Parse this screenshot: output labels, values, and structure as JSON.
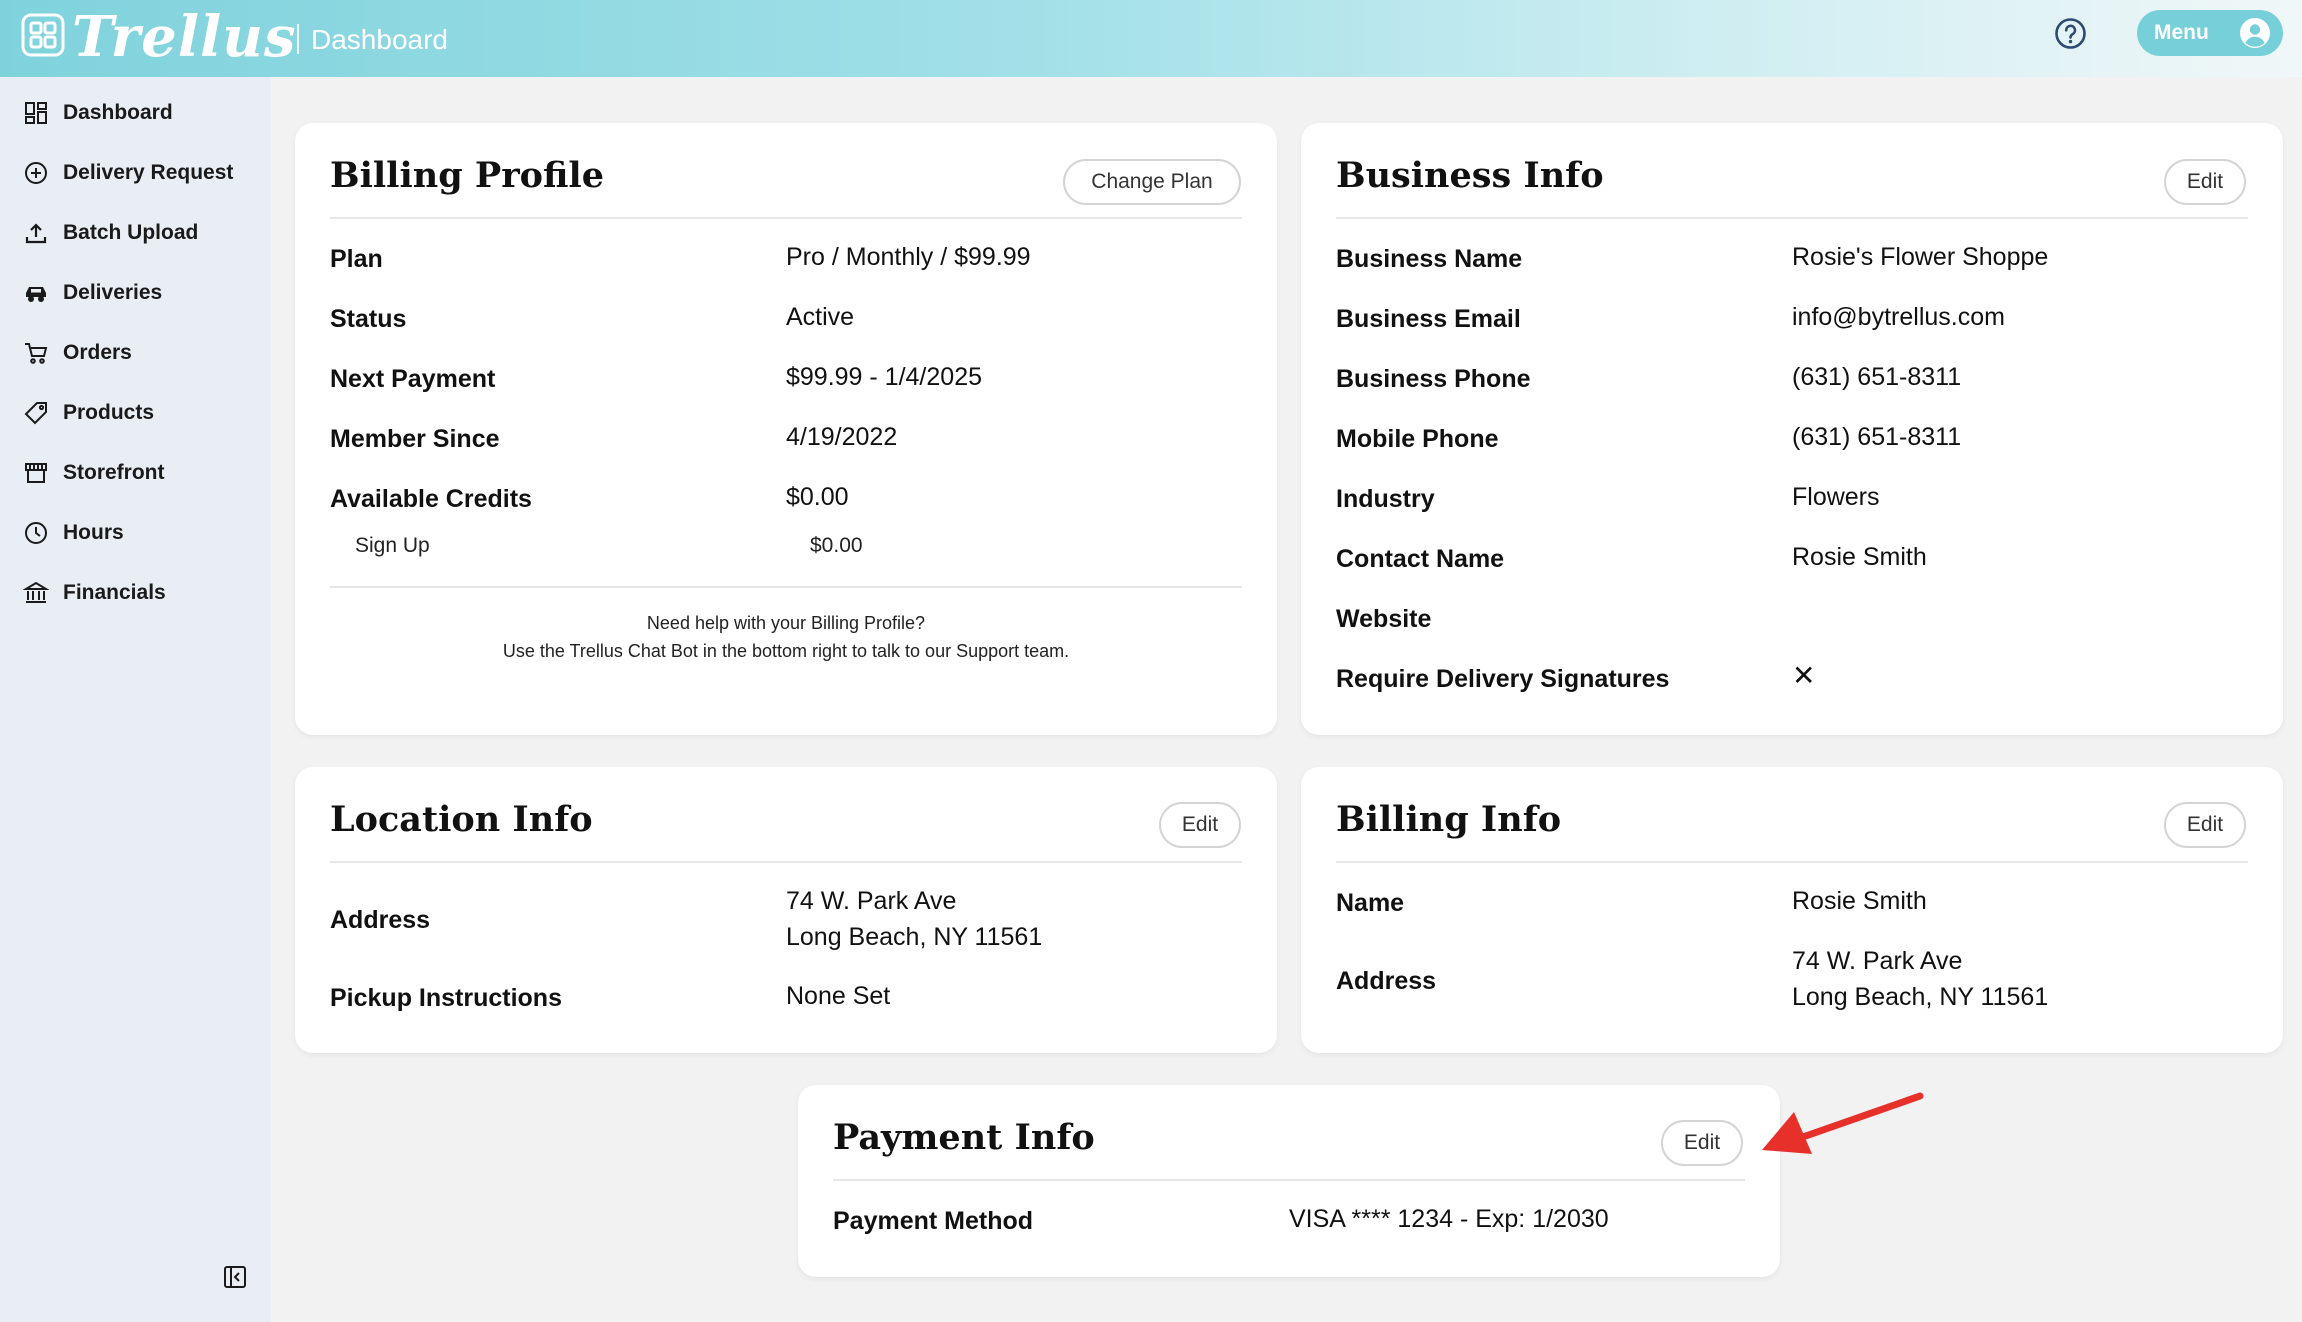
{
  "header": {
    "brand": "Trellus",
    "section": "Dashboard",
    "menu_label": "Menu",
    "icons": [
      "trellus-logo-icon",
      "help-icon",
      "user-avatar-icon"
    ]
  },
  "sidebar": {
    "items": [
      {
        "label": "Dashboard",
        "icon": "dashboard-icon"
      },
      {
        "label": "Delivery Request",
        "icon": "plus-circle-icon"
      },
      {
        "label": "Batch Upload",
        "icon": "upload-icon"
      },
      {
        "label": "Deliveries",
        "icon": "car-icon"
      },
      {
        "label": "Orders",
        "icon": "cart-icon"
      },
      {
        "label": "Products",
        "icon": "tag-icon"
      },
      {
        "label": "Storefront",
        "icon": "storefront-icon"
      },
      {
        "label": "Hours",
        "icon": "clock-icon"
      },
      {
        "label": "Financials",
        "icon": "bank-icon"
      }
    ],
    "collapse_icon": "collapse-sidebar-icon"
  },
  "billing_profile": {
    "title": "Billing Profile",
    "action": "Change Plan",
    "rows": [
      {
        "label": "Plan",
        "value": "Pro / Monthly / $99.99"
      },
      {
        "label": "Status",
        "value": "Active"
      },
      {
        "label": "Next Payment",
        "value": "$99.99 - 1/4/2025"
      },
      {
        "label": "Member Since",
        "value": "4/19/2022"
      },
      {
        "label": "Available Credits",
        "value": "$0.00"
      }
    ],
    "sub_row": {
      "label": "Sign Up",
      "value": "$0.00"
    },
    "help_line1": "Need help with your Billing Profile?",
    "help_line2": "Use the Trellus Chat Bot in the bottom right to talk to our Support team."
  },
  "business_info": {
    "title": "Business Info",
    "action": "Edit",
    "rows": [
      {
        "label": "Business Name",
        "value": "Rosie's Flower Shoppe"
      },
      {
        "label": "Business Email",
        "value": "info@bytrellus.com"
      },
      {
        "label": "Business Phone",
        "value": "(631) 651-8311"
      },
      {
        "label": "Mobile Phone",
        "value": "(631) 651-8311"
      },
      {
        "label": "Industry",
        "value": "Flowers"
      },
      {
        "label": "Contact Name",
        "value": "Rosie Smith"
      },
      {
        "label": "Website",
        "value": ""
      },
      {
        "label": "Require Delivery Signatures",
        "value": "✕"
      }
    ]
  },
  "location_info": {
    "title": "Location Info",
    "action": "Edit",
    "address_label": "Address",
    "address_line1": "74 W. Park Ave",
    "address_line2": "Long Beach, NY 11561",
    "pickup_label": "Pickup Instructions",
    "pickup_value": "None Set"
  },
  "billing_info": {
    "title": "Billing Info",
    "action": "Edit",
    "name_label": "Name",
    "name_value": "Rosie Smith",
    "address_label": "Address",
    "address_line1": "74 W. Park Ave",
    "address_line2": "Long Beach, NY 11561"
  },
  "payment_info": {
    "title": "Payment Info",
    "action": "Edit",
    "method_label": "Payment Method",
    "method_value": "VISA **** 1234 - Exp: 1/2030"
  },
  "annotation": {
    "arrow_color": "#e8302a"
  },
  "colors": {
    "accent": "#76cfd9",
    "sidebar_bg": "#e8eef3",
    "page_bg": "#f2f2f2"
  }
}
